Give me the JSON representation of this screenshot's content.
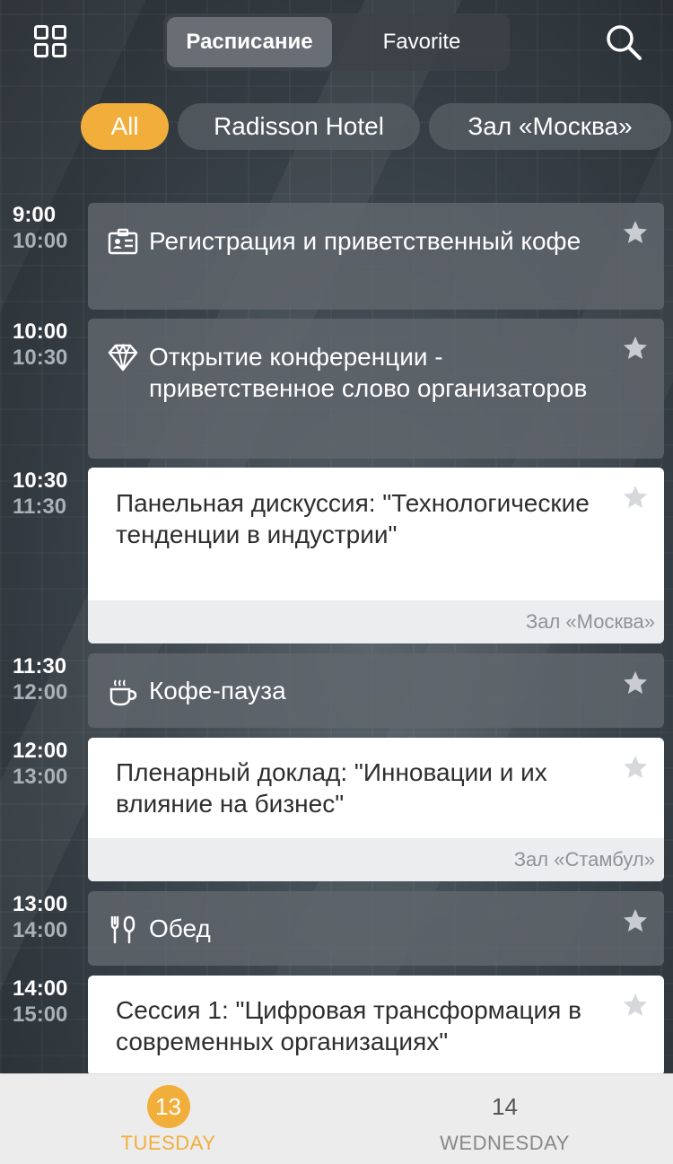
{
  "header": {
    "tabs": [
      {
        "label": "Расписание",
        "active": true
      },
      {
        "label": "Favorite",
        "active": false
      }
    ],
    "icons": {
      "left": "grid-icon",
      "right": "search-icon"
    }
  },
  "filters": [
    {
      "label": "All",
      "active": true
    },
    {
      "label": "Radisson Hotel",
      "active": false
    },
    {
      "label": "Зал «Москва»",
      "active": false
    }
  ],
  "sessions": [
    {
      "start": "9:00",
      "end": "10:00",
      "title": "Регистрация и приветственный кофе",
      "icon": "badge-icon",
      "style": "dark",
      "room": ""
    },
    {
      "start": "10:00",
      "end": "10:30",
      "title": "Открытие конференции - приветственное слово организаторов",
      "icon": "diamond-icon",
      "style": "dark",
      "room": ""
    },
    {
      "start": "10:30",
      "end": "11:30",
      "title": "Панельная дискуссия: \"Технологические тенденции в индустрии\"",
      "icon": "",
      "style": "light",
      "room": "Зал «Москва»"
    },
    {
      "start": "11:30",
      "end": "12:00",
      "title": "Кофе-пауза",
      "icon": "coffee-icon",
      "style": "dark",
      "room": ""
    },
    {
      "start": "12:00",
      "end": "13:00",
      "title": "Пленарный доклад: \"Инновации и их влияние на бизнес\"",
      "icon": "",
      "style": "light",
      "room": "Зал «Стамбул»"
    },
    {
      "start": "13:00",
      "end": "14:00",
      "title": "Обед",
      "icon": "cutlery-icon",
      "style": "dark",
      "room": ""
    },
    {
      "start": "14:00",
      "end": "15:00",
      "title": "Сессия 1: \"Цифровая трансформация в современных организациях\"",
      "icon": "",
      "style": "light",
      "room": ""
    }
  ],
  "tabbar": [
    {
      "number": "13",
      "label": "TUESDAY",
      "active": true
    },
    {
      "number": "14",
      "label": "WEDNESDAY",
      "active": false
    }
  ],
  "colors": {
    "accent": "#f1ae3b",
    "card_dark": "#60676d",
    "card_light": "#ffffff",
    "room_bar": "#ebedef"
  }
}
